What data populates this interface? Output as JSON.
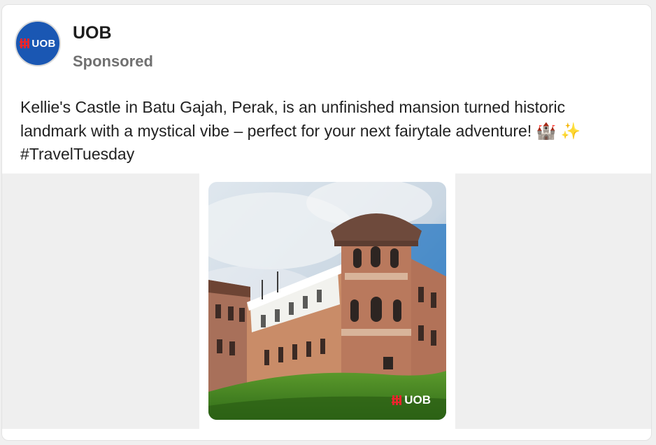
{
  "post": {
    "author": "UOB",
    "label": "Sponsored",
    "avatar_text": "UOB",
    "text_line1": "Kellie's Castle in Batu Gajah, Perak, is an unfinished mansion turned historic",
    "text_line2": "landmark with a mystical vibe – perfect for your next fairytale adventure! 🏰 ✨",
    "text_line3": "#TravelTuesday",
    "image_watermark": "UOB"
  },
  "colors": {
    "brand_blue": "#1a57b3",
    "brand_red": "#e8262d"
  }
}
